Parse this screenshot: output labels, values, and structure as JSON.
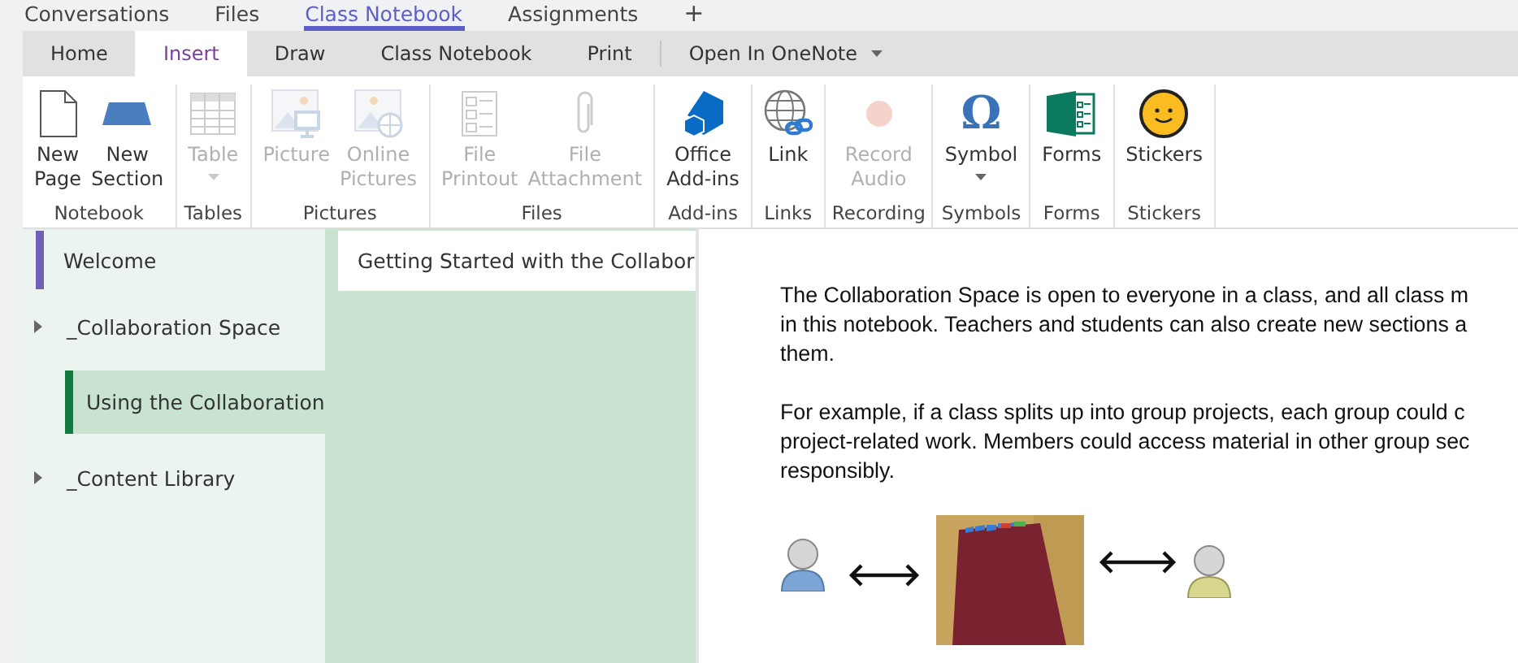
{
  "app_tabs": [
    {
      "label": "Conversations",
      "selected": false
    },
    {
      "label": "Files",
      "selected": false
    },
    {
      "label": "Class Notebook",
      "selected": true
    },
    {
      "label": "Assignments",
      "selected": false
    }
  ],
  "add_tab": "+",
  "ribbon_tabs": [
    {
      "label": "Home",
      "selected": false,
      "dropdown": false
    },
    {
      "label": "Insert",
      "selected": true,
      "dropdown": false
    },
    {
      "label": "Draw",
      "selected": false,
      "dropdown": false
    },
    {
      "label": "Class Notebook",
      "selected": false,
      "dropdown": false
    },
    {
      "label": "Print",
      "selected": false,
      "dropdown": false
    },
    {
      "label": "Open In OneNote",
      "selected": false,
      "dropdown": true
    }
  ],
  "ribbon_groups": [
    {
      "label": "Notebook",
      "commands": [
        {
          "kind": "page",
          "lines": [
            "New",
            "Page"
          ],
          "disabled": false,
          "dropdown": false
        },
        {
          "kind": "section",
          "lines": [
            "New",
            "Section"
          ],
          "disabled": false,
          "dropdown": false
        }
      ]
    },
    {
      "label": "Tables",
      "commands": [
        {
          "kind": "table",
          "lines": [
            "Table"
          ],
          "disabled": true,
          "dropdown": true
        }
      ]
    },
    {
      "label": "Pictures",
      "commands": [
        {
          "kind": "picture",
          "lines": [
            "Picture"
          ],
          "disabled": true,
          "dropdown": false
        },
        {
          "kind": "online-picture",
          "lines": [
            "Online",
            "Pictures"
          ],
          "disabled": true,
          "dropdown": false
        }
      ]
    },
    {
      "label": "Files",
      "commands": [
        {
          "kind": "printout",
          "lines": [
            "File",
            "Printout"
          ],
          "disabled": true,
          "dropdown": false
        },
        {
          "kind": "attachment",
          "lines": [
            "File",
            "Attachment"
          ],
          "disabled": true,
          "dropdown": false
        }
      ]
    },
    {
      "label": "Add-ins",
      "commands": [
        {
          "kind": "addins",
          "lines": [
            "Office",
            "Add-ins"
          ],
          "disabled": false,
          "dropdown": false
        }
      ]
    },
    {
      "label": "Links",
      "commands": [
        {
          "kind": "link",
          "lines": [
            "Link"
          ],
          "disabled": false,
          "dropdown": false
        }
      ]
    },
    {
      "label": "Recording",
      "commands": [
        {
          "kind": "record",
          "lines": [
            "Record",
            "Audio"
          ],
          "disabled": true,
          "dropdown": false
        }
      ]
    },
    {
      "label": "Symbols",
      "commands": [
        {
          "kind": "symbol",
          "glyph": "Ω",
          "lines": [
            "Symbol"
          ],
          "disabled": false,
          "dropdown": true
        }
      ]
    },
    {
      "label": "Forms",
      "commands": [
        {
          "kind": "forms",
          "lines": [
            "Forms"
          ],
          "disabled": false,
          "dropdown": false
        }
      ]
    },
    {
      "label": "Stickers",
      "commands": [
        {
          "kind": "stickers",
          "lines": [
            "Stickers"
          ],
          "disabled": false,
          "dropdown": false
        }
      ]
    }
  ],
  "sections": [
    {
      "label": "Welcome",
      "kind": "section",
      "color": "#7160b3",
      "selected": false
    },
    {
      "label": "_Collaboration Space",
      "kind": "group",
      "children": [
        {
          "label": "Using the Collaboration",
          "kind": "section",
          "color": "#0f7b3f",
          "selected": true
        }
      ]
    },
    {
      "label": "_Content Library",
      "kind": "group"
    }
  ],
  "pages": [
    {
      "label": "Getting Started with the Collabor",
      "selected": true
    }
  ],
  "content": {
    "paragraphs": [
      [
        "The Collaboration Space is open to everyone in a class, and all class m",
        "in this notebook.  Teachers and students can also create new sections a",
        "them."
      ],
      [
        "For example, if a class splits up into group projects, each group could c",
        "project-related work. Members could access material in other group sec",
        "responsibly."
      ]
    ]
  }
}
